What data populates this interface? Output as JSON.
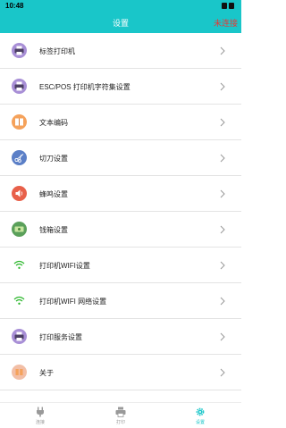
{
  "status_bar": {
    "time": "10:48"
  },
  "header": {
    "title": "设置",
    "connection_status": "未连接"
  },
  "colors": {
    "accent": "#19c6c9",
    "disconnected": "#e53935",
    "icon_purple": "#a88fd6",
    "icon_orange": "#f5a25b",
    "icon_blue": "#5b7fc7",
    "icon_red": "#e8604a",
    "icon_green": "#5aa05a",
    "icon_wifi": "#2db82d",
    "icon_peach": "#f2bfa7"
  },
  "menu": [
    {
      "label": "标签打印机",
      "icon": "printer-icon"
    },
    {
      "label": "ESC/POS 打印机字符集设置",
      "icon": "printer-icon"
    },
    {
      "label": "文本编码",
      "icon": "book-icon"
    },
    {
      "label": "切刀设置",
      "icon": "scissors-icon"
    },
    {
      "label": "蜂鸣设置",
      "icon": "speaker-icon"
    },
    {
      "label": "钱箱设置",
      "icon": "cash-drawer-icon"
    },
    {
      "label": "打印机WIFI设置",
      "icon": "wifi-icon"
    },
    {
      "label": "打印机WIFI 网络设置",
      "icon": "wifi-icon"
    },
    {
      "label": "打印服务设置",
      "icon": "printer-icon"
    },
    {
      "label": "关于",
      "icon": "info-icon"
    }
  ],
  "bottom_nav": [
    {
      "label": "连接",
      "icon": "plug-icon"
    },
    {
      "label": "打印",
      "icon": "printer-icon"
    },
    {
      "label": "设置",
      "icon": "gear-icon",
      "active": true
    }
  ]
}
